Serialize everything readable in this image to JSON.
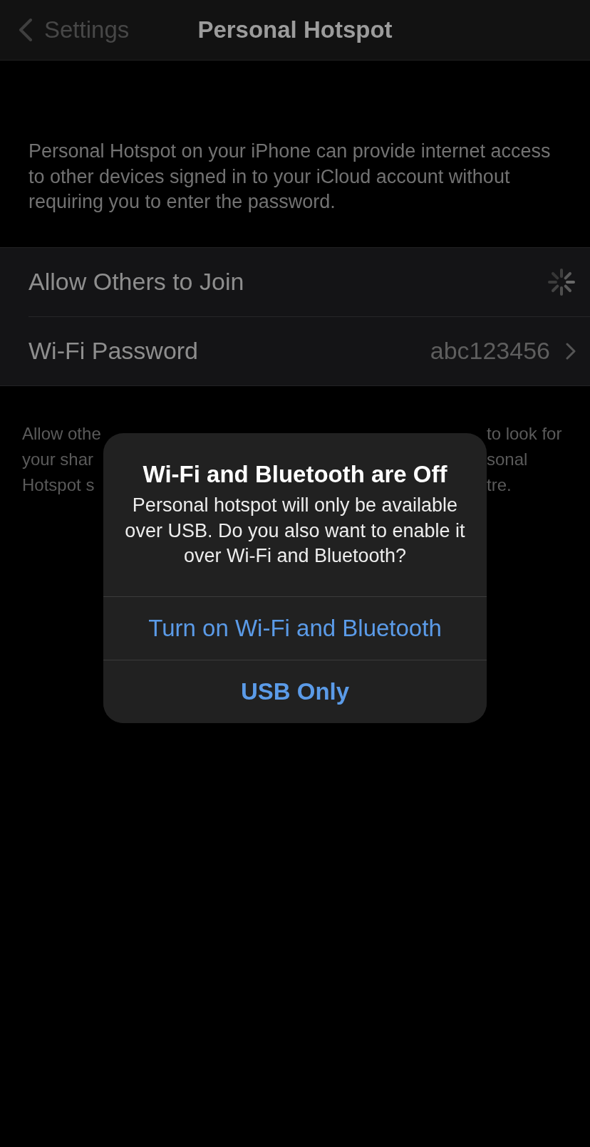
{
  "nav_bar": {
    "back_label": "Settings",
    "title": "Personal Hotspot"
  },
  "description": "Personal Hotspot on your iPhone can provide internet access to other devices signed in to your iCloud account without requiring you to enter the password.",
  "settings_rows": [
    {
      "kind": "spinner",
      "label": "Allow Others to Join"
    },
    {
      "kind": "disclosure",
      "label": "Wi-Fi Password",
      "value": "abc123456"
    }
  ],
  "footer_fragments": [
    {
      "left": "Allow othe",
      "right": "to look for"
    },
    {
      "left": "your shar",
      "right": "sonal"
    },
    {
      "left": "Hotspot s",
      "right": "tre."
    }
  ],
  "alert": {
    "title": "Wi-Fi and Bluetooth are Off",
    "message": "Personal hotspot will only be available over USB. Do you also want to enable it over Wi-Fi and Bluetooth?",
    "actions": [
      {
        "label": "Turn on Wi-Fi and Bluetooth",
        "kind": "normal"
      },
      {
        "label": "USB Only",
        "kind": "preferred"
      }
    ]
  }
}
